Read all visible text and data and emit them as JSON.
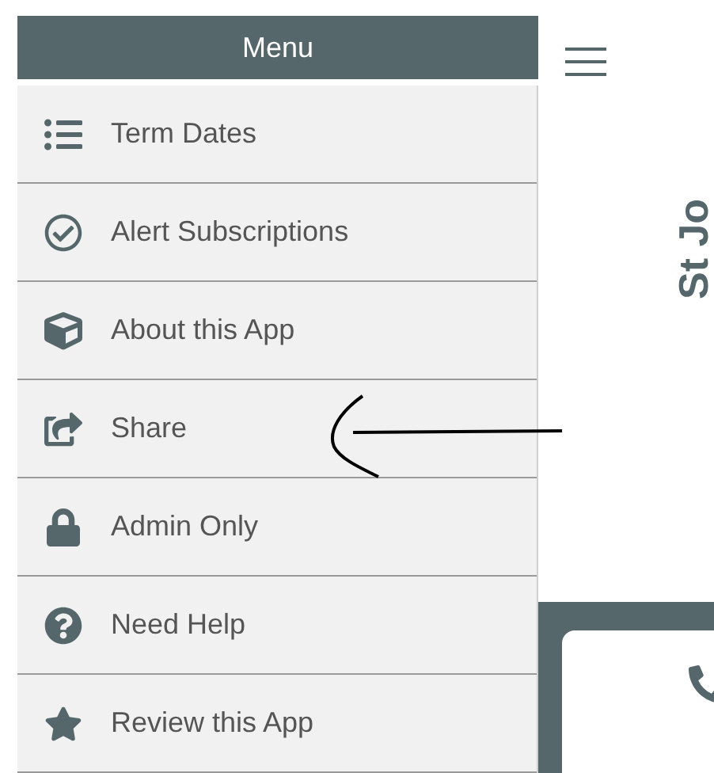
{
  "menu": {
    "title": "Menu",
    "items": [
      {
        "label": "Term Dates"
      },
      {
        "label": "Alert Subscriptions"
      },
      {
        "label": "About this App"
      },
      {
        "label": "Share"
      },
      {
        "label": "Admin Only"
      },
      {
        "label": "Need Help"
      },
      {
        "label": "Review this App"
      }
    ]
  },
  "app": {
    "vertical_title": "St Jo"
  }
}
